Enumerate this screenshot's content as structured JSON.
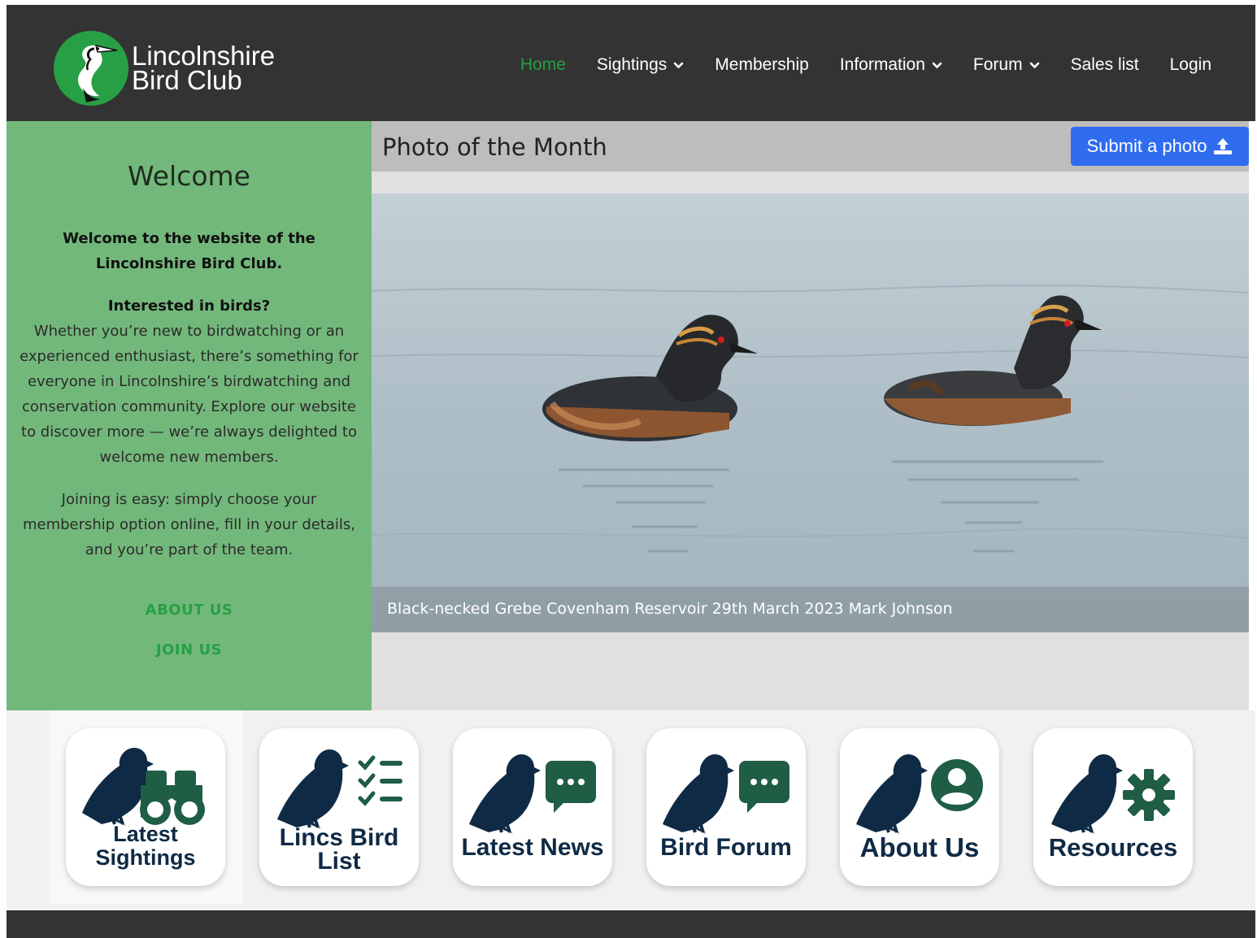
{
  "header": {
    "logo_line1": "Lincolnshire",
    "logo_line2": "Bird Club",
    "nav": [
      {
        "label": "Home",
        "dropdown": false,
        "active": true
      },
      {
        "label": "Sightings",
        "dropdown": true,
        "active": false
      },
      {
        "label": "Membership",
        "dropdown": false,
        "active": false
      },
      {
        "label": "Information",
        "dropdown": true,
        "active": false
      },
      {
        "label": "Forum",
        "dropdown": true,
        "active": false
      },
      {
        "label": "Sales list",
        "dropdown": false,
        "active": false
      },
      {
        "label": "Login",
        "dropdown": false,
        "active": false
      }
    ]
  },
  "welcome": {
    "title": "Welcome",
    "intro": "Welcome to the website of the Lincolnshire Bird Club.",
    "subheading": "Interested in birds?",
    "body": "Whether you’re new to birdwatching or an experienced enthusiast, there’s something for everyone in Lincolnshire’s birdwatching and conservation community. Explore our website to discover more — we’re always delighted to welcome new members.",
    "body2": "Joining is easy: simply choose your membership option online, fill in your details, and you’re part of the team.",
    "link_about": "ABOUT US",
    "link_join": "JOIN US"
  },
  "photo_of_month": {
    "title": "Photo of the Month",
    "submit_label": "Submit a photo",
    "caption": "Black-necked Grebe Covenham Reservoir 29th March 2023 Mark Johnson"
  },
  "tiles": [
    {
      "line1": "Latest",
      "line2": "Sightings",
      "icon": "binoculars-icon"
    },
    {
      "line1": "Lincs Bird",
      "line2": "List",
      "icon": "checklist-icon"
    },
    {
      "line1": "Latest News",
      "line2": "",
      "icon": "chat-bubble-icon"
    },
    {
      "line1": "Bird Forum",
      "line2": "",
      "icon": "chat-bubble-icon"
    },
    {
      "line1": "About Us",
      "line2": "",
      "icon": "user-circle-icon"
    },
    {
      "line1": "Resources",
      "line2": "",
      "icon": "gear-icon"
    }
  ],
  "colors": {
    "header_bg": "#333333",
    "brand_green": "#27a045",
    "welcome_bg": "#73b87b",
    "submit_blue": "#2f6cf0",
    "tile_navy": "#0f2a44",
    "tile_green": "#1f5d45"
  }
}
